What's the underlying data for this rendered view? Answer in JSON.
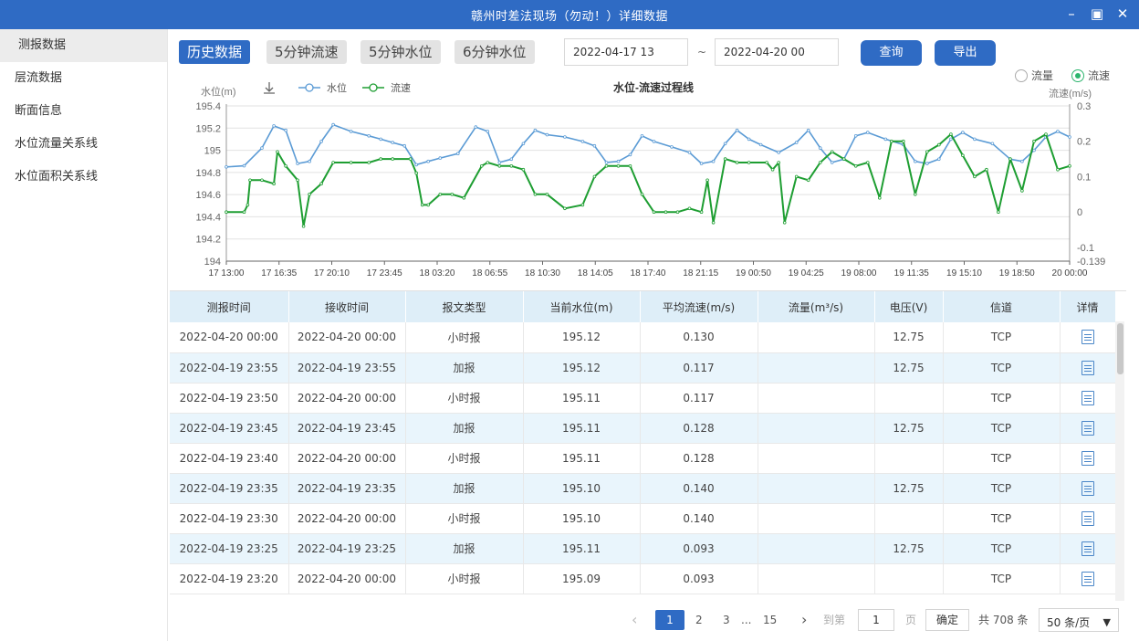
{
  "window": {
    "title": "赣州时差法现场（勿动！）详细数据"
  },
  "sidebar": {
    "items": [
      {
        "label": "测报数据"
      },
      {
        "label": "层流数据"
      },
      {
        "label": "断面信息"
      },
      {
        "label": "水位流量关系线"
      },
      {
        "label": "水位面积关系线"
      }
    ]
  },
  "toolbar": {
    "tabs": [
      {
        "label": "历史数据"
      },
      {
        "label": "5分钟流速"
      },
      {
        "label": "5分钟水位"
      },
      {
        "label": "6分钟水位"
      }
    ],
    "start_date": "2022-04-17 13",
    "separator": "~",
    "end_date": "2022-04-20 00",
    "query_label": "查询",
    "export_label": "导出",
    "radio_flow": "流量",
    "radio_speed": "流速",
    "selected": "流速"
  },
  "colors": {
    "accent": "#2f6bc4",
    "level_series": "#5b9bd5",
    "speed_series": "#1e9e32"
  },
  "chart_data": {
    "type": "line",
    "title": "水位-流速过程线",
    "ylabel_left": "水位(m)",
    "ylabel_right": "流速(m/s)",
    "legend": [
      "水位",
      "流速"
    ],
    "legend_position": "top-left",
    "grid": true,
    "ylim_left": [
      194,
      195.4
    ],
    "ylim_right": [
      -0.139,
      0.3
    ],
    "left_ticks": [
      "195.4",
      "195.2",
      "195",
      "194.8",
      "194.6",
      "194.4",
      "194.2",
      "194"
    ],
    "right_ticks": [
      "0.3",
      "0.2",
      "0.1",
      "0",
      "-0.1",
      "-0.139"
    ],
    "x_ticks": [
      "17 13:00",
      "17 16:35",
      "17 20:10",
      "17 23:45",
      "18 03:20",
      "18 06:55",
      "18 10:30",
      "18 14:05",
      "18 17:40",
      "18 21:15",
      "19 00:50",
      "19 04:25",
      "19 08:00",
      "19 11:35",
      "19 15:10",
      "19 18:50",
      "20 00:00"
    ],
    "series": [
      {
        "name": "水位",
        "axis": "left",
        "x": [
          0,
          1.5,
          3.0,
          4.0,
          5.0,
          6.0,
          7.0,
          8.0,
          9.0,
          10.5,
          12.0,
          13.0,
          14.0,
          15.0,
          16.0,
          17.0,
          18.0,
          19.5,
          21.0,
          22.0,
          23.0,
          24.0,
          25.0,
          26.0,
          27.0,
          28.5,
          30.0,
          31.0,
          32.0,
          33.0,
          34.0,
          35.0,
          36.0,
          37.5,
          39.0,
          40.0,
          41.0,
          42.0,
          43.0,
          44.0,
          45.0,
          46.5,
          48.0,
          49.0,
          50.0,
          51.0,
          52.0,
          53.0,
          54.0,
          55.5,
          57.0,
          58.0,
          59.0,
          60.0,
          61.0,
          62.0,
          63.0,
          64.5,
          66.0,
          67.0,
          68.0,
          69.0,
          70.0,
          71.0
        ],
        "y": [
          194.85,
          194.86,
          195.02,
          195.22,
          195.18,
          194.88,
          194.9,
          195.08,
          195.23,
          195.17,
          195.13,
          195.1,
          195.07,
          195.04,
          194.87,
          194.9,
          194.93,
          194.97,
          195.21,
          195.17,
          194.89,
          194.92,
          195.06,
          195.18,
          195.14,
          195.12,
          195.08,
          195.04,
          194.89,
          194.9,
          194.96,
          195.13,
          195.08,
          195.03,
          194.98,
          194.88,
          194.9,
          195.06,
          195.18,
          195.1,
          195.05,
          194.98,
          195.07,
          195.18,
          195.02,
          194.89,
          194.92,
          195.13,
          195.16,
          195.1,
          195.05,
          194.9,
          194.88,
          194.92,
          195.1,
          195.16,
          195.1,
          195.06,
          194.92,
          194.9,
          195.0,
          195.12,
          195.17,
          195.12
        ]
      },
      {
        "name": "流速",
        "axis": "right",
        "x": [
          0,
          1.5,
          1.8,
          2.0,
          3.0,
          4.0,
          4.3,
          5.0,
          6.0,
          6.5,
          7.0,
          8.0,
          9.0,
          10.5,
          12.0,
          13.0,
          14.0,
          15.5,
          16.0,
          16.5,
          17.0,
          18.0,
          19.0,
          20.0,
          21.5,
          22.0,
          23.0,
          24.0,
          25.0,
          26.0,
          27.0,
          28.5,
          30.0,
          31.0,
          32.0,
          33.0,
          34.0,
          35.0,
          36.0,
          37.0,
          38.0,
          39.0,
          40.0,
          40.5,
          41.0,
          42.0,
          43.0,
          44.0,
          45.5,
          46.0,
          46.5,
          47.0,
          48.0,
          49.0,
          50.0,
          51.0,
          52.0,
          53.0,
          54.0,
          55.0,
          56.0,
          57.0,
          58.0,
          59.0,
          60.0,
          61.0,
          62.0,
          63.0,
          64.0,
          65.0,
          66.0,
          67.0,
          68.0,
          69.0,
          70.0,
          71.0
        ],
        "y": [
          0.0,
          0.0,
          0.02,
          0.09,
          0.09,
          0.08,
          0.17,
          0.13,
          0.09,
          -0.04,
          0.05,
          0.08,
          0.14,
          0.14,
          0.14,
          0.15,
          0.15,
          0.15,
          0.11,
          0.02,
          0.02,
          0.05,
          0.05,
          0.04,
          0.13,
          0.14,
          0.13,
          0.13,
          0.12,
          0.05,
          0.05,
          0.01,
          0.02,
          0.1,
          0.13,
          0.13,
          0.13,
          0.05,
          0.0,
          0.0,
          0.0,
          0.01,
          0.0,
          0.09,
          -0.03,
          0.15,
          0.14,
          0.14,
          0.14,
          0.12,
          0.14,
          -0.03,
          0.1,
          0.09,
          0.14,
          0.17,
          0.15,
          0.13,
          0.14,
          0.04,
          0.2,
          0.2,
          0.05,
          0.17,
          0.19,
          0.22,
          0.16,
          0.1,
          0.12,
          0.0,
          0.15,
          0.06,
          0.2,
          0.22,
          0.12,
          0.13
        ]
      }
    ]
  },
  "table": {
    "headers": [
      "测报时间",
      "接收时间",
      "报文类型",
      "当前水位(m)",
      "平均流速(m/s)",
      "流量(m³/s)",
      "电压(V)",
      "信道",
      "详情"
    ],
    "rows": [
      [
        "2022-04-20 00:00",
        "2022-04-20 00:00",
        "小时报",
        "195.12",
        "0.130",
        "",
        "12.75",
        "TCP"
      ],
      [
        "2022-04-19 23:55",
        "2022-04-19 23:55",
        "加报",
        "195.12",
        "0.117",
        "",
        "12.75",
        "TCP"
      ],
      [
        "2022-04-19 23:50",
        "2022-04-20 00:00",
        "小时报",
        "195.11",
        "0.117",
        "",
        "",
        "TCP"
      ],
      [
        "2022-04-19 23:45",
        "2022-04-19 23:45",
        "加报",
        "195.11",
        "0.128",
        "",
        "12.75",
        "TCP"
      ],
      [
        "2022-04-19 23:40",
        "2022-04-20 00:00",
        "小时报",
        "195.11",
        "0.128",
        "",
        "",
        "TCP"
      ],
      [
        "2022-04-19 23:35",
        "2022-04-19 23:35",
        "加报",
        "195.10",
        "0.140",
        "",
        "12.75",
        "TCP"
      ],
      [
        "2022-04-19 23:30",
        "2022-04-20 00:00",
        "小时报",
        "195.10",
        "0.140",
        "",
        "",
        "TCP"
      ],
      [
        "2022-04-19 23:25",
        "2022-04-19 23:25",
        "加报",
        "195.11",
        "0.093",
        "",
        "12.75",
        "TCP"
      ],
      [
        "2022-04-19 23:20",
        "2022-04-20 00:00",
        "小时报",
        "195.09",
        "0.093",
        "",
        "",
        "TCP"
      ]
    ]
  },
  "pager": {
    "prev": "‹",
    "next": "›",
    "pages": [
      "1",
      "2",
      "3",
      "...",
      "15"
    ],
    "goto_label": "到第",
    "goto_value": "1",
    "page_unit": "页",
    "confirm_label": "确定",
    "total_label": "共 708 条",
    "page_size": "50 条/页"
  }
}
